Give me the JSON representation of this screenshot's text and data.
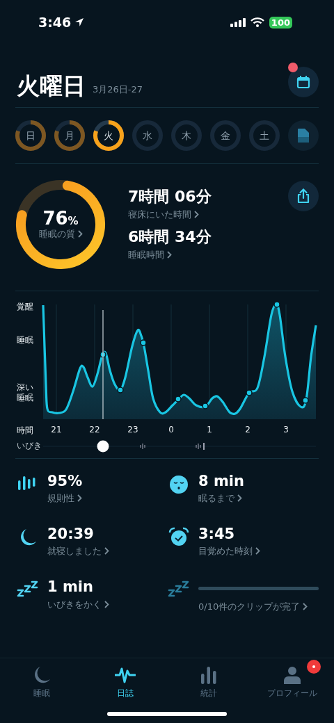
{
  "status_bar": {
    "time": "3:46",
    "battery": "100"
  },
  "header": {
    "title": "火曜日",
    "date": "3月26日-27",
    "calendar_badge": true
  },
  "days": [
    {
      "label": "日",
      "completed": true,
      "selected": false
    },
    {
      "label": "月",
      "completed": true,
      "selected": false
    },
    {
      "label": "火",
      "completed": true,
      "selected": true
    },
    {
      "label": "水",
      "completed": false,
      "selected": false
    },
    {
      "label": "木",
      "completed": false,
      "selected": false
    },
    {
      "label": "金",
      "completed": false,
      "selected": false
    },
    {
      "label": "土",
      "completed": false,
      "selected": false
    }
  ],
  "summary": {
    "quality": "76",
    "unit": "%",
    "quality_label": "睡眠の質",
    "times": [
      {
        "value": "7時間 06分",
        "label": "寝床にいた時間"
      },
      {
        "value": "6時間 34分",
        "label": "睡眠時間"
      }
    ]
  },
  "graph": {
    "y_labels": [
      "覚醒",
      "睡眠",
      "深い睡眠"
    ],
    "x_axis_label": "時間",
    "x_labels": [
      "21",
      "22",
      "23",
      "0",
      "1",
      "2",
      "3"
    ],
    "snore_label": "いびき"
  },
  "stats": [
    {
      "kind": "regularity",
      "value": "95%",
      "label": "規則性"
    },
    {
      "kind": "fall_asleep",
      "value": "8 min",
      "label": "眠るまで"
    },
    {
      "kind": "bedtime",
      "value": "20:39",
      "label": "就寝しました"
    },
    {
      "kind": "wake",
      "value": "3:45",
      "label": "目覚めた時刻"
    },
    {
      "kind": "snore",
      "value": "1 min",
      "label": "いびきをかく"
    },
    {
      "kind": "clips",
      "level": 0,
      "label": "0/10件のクリップが完了"
    }
  ],
  "tabs": [
    {
      "kind": "sleep",
      "label": "睡眠",
      "selected": false,
      "badge": false
    },
    {
      "kind": "journal",
      "label": "日誌",
      "selected": true,
      "badge": false
    },
    {
      "kind": "stats",
      "label": "統計",
      "selected": false,
      "badge": false
    },
    {
      "kind": "profile",
      "label": "プロフィール",
      "selected": false,
      "badge": true
    }
  ]
}
